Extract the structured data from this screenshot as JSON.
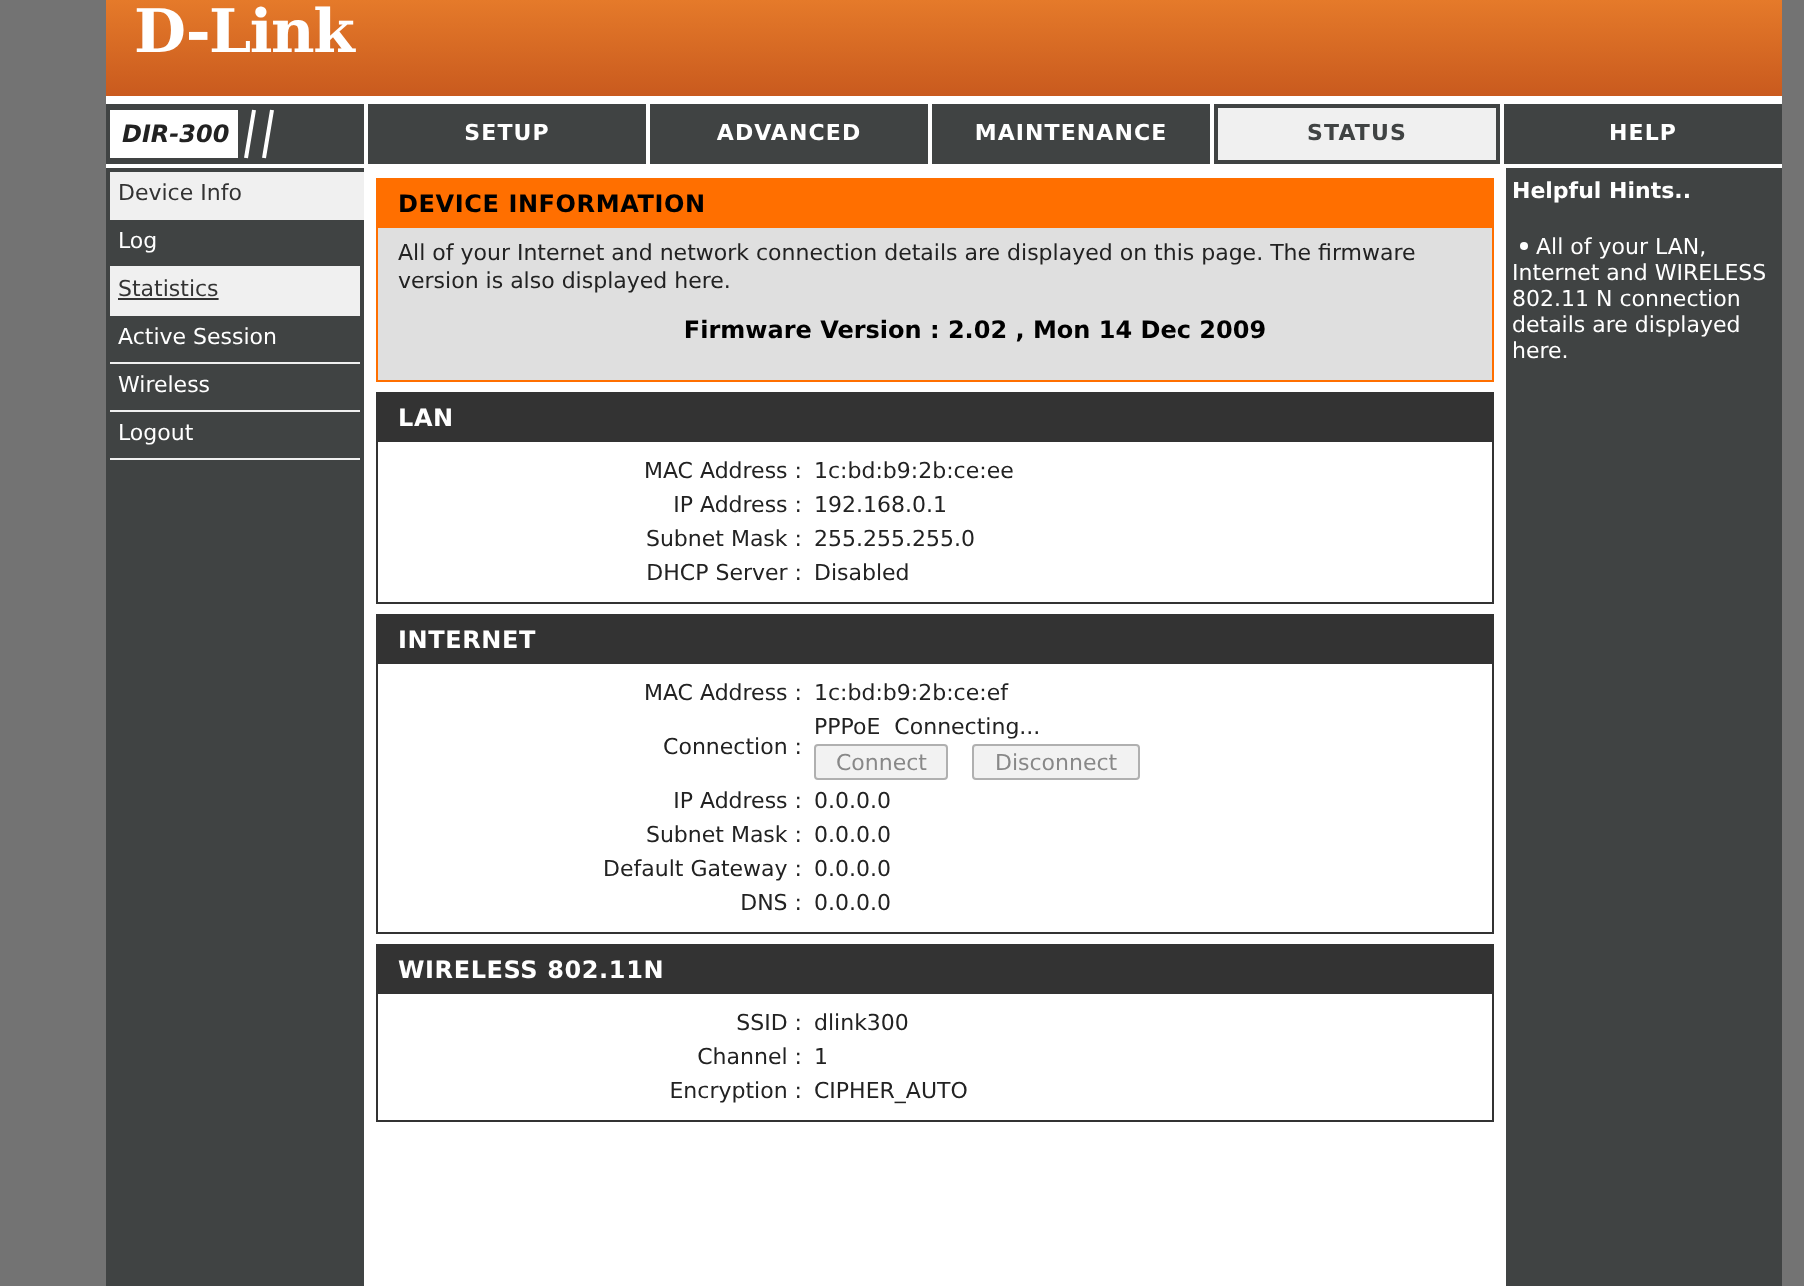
{
  "logo": "D-Link",
  "model": "DIR-300",
  "tabs": [
    {
      "label": "SETUP",
      "selected": false
    },
    {
      "label": "ADVANCED",
      "selected": false
    },
    {
      "label": "MAINTENANCE",
      "selected": false
    },
    {
      "label": "STATUS",
      "selected": true
    },
    {
      "label": "HELP",
      "selected": false
    }
  ],
  "sidebar": {
    "items": [
      {
        "label": "Device Info",
        "selected": true,
        "hovered": false
      },
      {
        "label": "Log",
        "selected": false,
        "hovered": false
      },
      {
        "label": "Statistics",
        "selected": false,
        "hovered": true
      },
      {
        "label": "Active Session",
        "selected": false,
        "hovered": false
      },
      {
        "label": "Wireless",
        "selected": false,
        "hovered": false
      },
      {
        "label": "Logout",
        "selected": false,
        "hovered": false
      }
    ]
  },
  "device_information": {
    "title": "DEVICE INFORMATION",
    "description": "All of your Internet and network connection details are displayed on this page. The firmware version is also displayed here.",
    "firmware": "Firmware Version : 2.02 ,  Mon 14 Dec 2009"
  },
  "sections": [
    {
      "title": "LAN",
      "rows": [
        {
          "kind": "text",
          "label": "MAC Address :",
          "value": "1c:bd:b9:2b:ce:ee"
        },
        {
          "kind": "text",
          "label": "IP Address :",
          "value": "192.168.0.1"
        },
        {
          "kind": "text",
          "label": "Subnet Mask :",
          "value": "255.255.255.0"
        },
        {
          "kind": "text",
          "label": "DHCP Server :",
          "value": "Disabled"
        }
      ]
    },
    {
      "title": "INTERNET",
      "rows": [
        {
          "kind": "text",
          "label": "MAC Address :",
          "value": "1c:bd:b9:2b:ce:ef"
        },
        {
          "kind": "connection",
          "label": "Connection :",
          "value": "PPPoE  Connecting...",
          "buttons": [
            {
              "label": "Connect",
              "disabled": true
            },
            {
              "label": "Disconnect",
              "disabled": true
            }
          ]
        },
        {
          "kind": "text",
          "label": "IP Address :",
          "value": "0.0.0.0"
        },
        {
          "kind": "text",
          "label": "Subnet Mask :",
          "value": "0.0.0.0"
        },
        {
          "kind": "text",
          "label": "Default Gateway :",
          "value": "0.0.0.0"
        },
        {
          "kind": "text",
          "label": "DNS :",
          "value": "0.0.0.0"
        }
      ]
    },
    {
      "title": "WIRELESS 802.11N",
      "rows": [
        {
          "kind": "text",
          "label": "SSID :",
          "value": "dlink300"
        },
        {
          "kind": "text",
          "label": "Channel :",
          "value": "1"
        },
        {
          "kind": "text",
          "label": "Encryption :",
          "value": "CIPHER_AUTO"
        }
      ]
    }
  ],
  "help": {
    "title": "Helpful Hints..",
    "hints": [
      "All of your LAN, Internet and WIRELESS 802.11 N connection details are displayed here."
    ]
  }
}
